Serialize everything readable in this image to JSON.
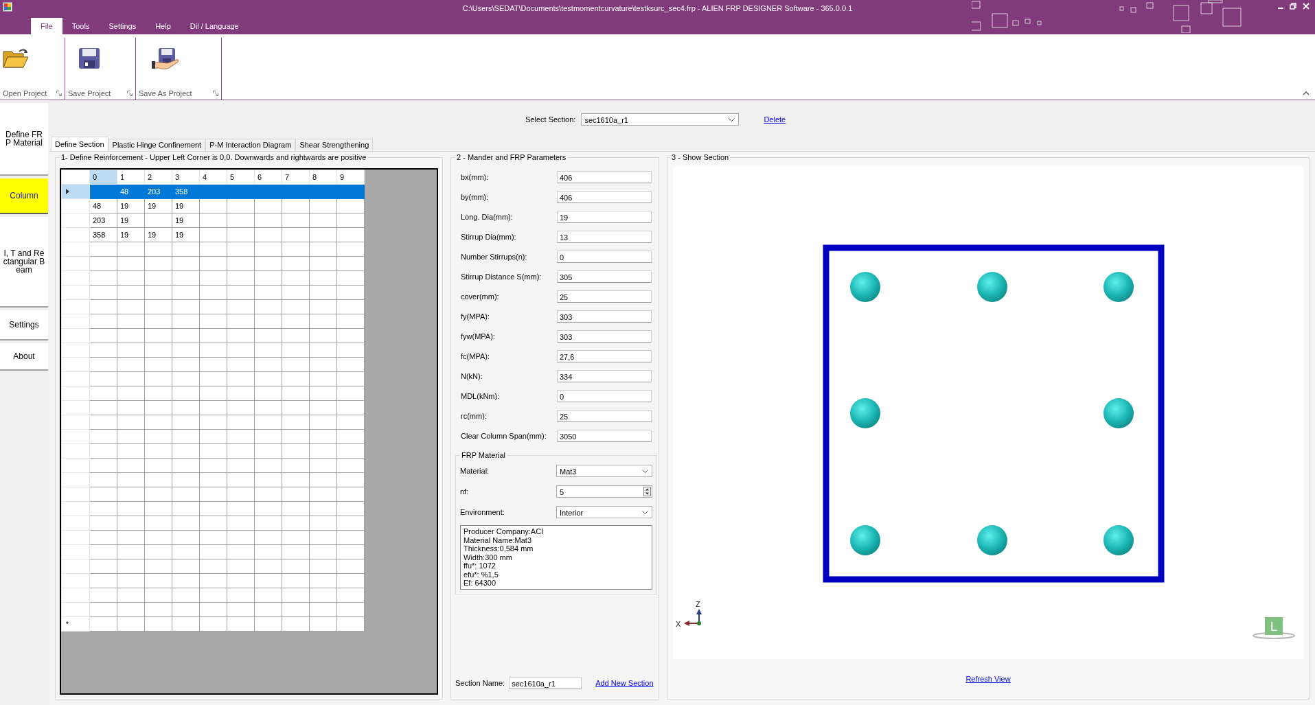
{
  "window": {
    "title": "C:\\Users\\SEDAT\\Documents\\testmomentcurvature\\testksurc_sec4.frp - ALIEN FRP DESIGNER Software - 365.0.0.1"
  },
  "menu": [
    {
      "label": "File",
      "selected": true
    },
    {
      "label": "Tools",
      "selected": false
    },
    {
      "label": "Settings",
      "selected": false
    },
    {
      "label": "Help",
      "selected": false
    },
    {
      "label": "Dil / Language",
      "selected": false
    }
  ],
  "ribbon": {
    "buttons": [
      {
        "label": "Open Project",
        "kind": "open"
      },
      {
        "label": "Save Project",
        "kind": "save"
      },
      {
        "label": "Save As Project",
        "kind": "save_as"
      }
    ]
  },
  "sidebar": {
    "items": [
      {
        "label": "Define FRP Material",
        "selected": false
      },
      {
        "label": "Column",
        "selected": true
      },
      {
        "label": "I, T and Rectangular Beam",
        "selected": false
      },
      {
        "label": "Settings",
        "selected": false
      },
      {
        "label": "About",
        "selected": false
      }
    ]
  },
  "section_select": {
    "label": "Select Section:",
    "value": "sec1610a_r1",
    "delete_link": "Delete"
  },
  "tabs": [
    {
      "label": "Define Section",
      "selected": true
    },
    {
      "label": "Plastic Hinge Confinement",
      "selected": false
    },
    {
      "label": "P-M Interaction Diagram",
      "selected": false
    },
    {
      "label": "Shear Strengthening",
      "selected": false
    }
  ],
  "reinforcement": {
    "title": "1- Define Reinforcement - Upper Left Corner is 0,0. Downwards and rightwards are positive",
    "columns": [
      {
        "label": "0",
        "selected": true
      },
      {
        "label": "1",
        "selected": false
      },
      {
        "label": "2",
        "selected": false
      },
      {
        "label": "3",
        "selected": false
      },
      {
        "label": "4",
        "selected": false
      },
      {
        "label": "5",
        "selected": false
      },
      {
        "label": "6",
        "selected": false
      },
      {
        "label": "7",
        "selected": false
      },
      {
        "label": "8",
        "selected": false
      },
      {
        "label": "9",
        "selected": false
      }
    ],
    "rows": [
      {
        "selected": true,
        "cells": [
          null,
          "48",
          "203",
          "358"
        ]
      },
      {
        "selected": false,
        "cells": [
          "48",
          "19",
          "19",
          "19"
        ]
      },
      {
        "selected": false,
        "cells": [
          "203",
          "19",
          null,
          "19"
        ]
      },
      {
        "selected": false,
        "cells": [
          "358",
          "19",
          "19",
          "19"
        ]
      }
    ],
    "new_row_marker": "*"
  },
  "parameters": {
    "title": "2 - Mander and  FRP Parameters",
    "fields": [
      {
        "label": "bx(mm):",
        "value": "406"
      },
      {
        "label": "by(mm):",
        "value": "406"
      },
      {
        "label": "Long. Dia(mm):",
        "value": "19"
      },
      {
        "label": "Stirrup Dia(mm):",
        "value": "13"
      },
      {
        "label": "Number Stirrups(n):",
        "value": "0"
      },
      {
        "label": "Stirrup Distance S(mm):",
        "value": "305"
      },
      {
        "label": "cover(mm):",
        "value": "25"
      },
      {
        "label": "fy(MPA):",
        "value": "303"
      },
      {
        "label": "fyw(MPA):",
        "value": "303"
      },
      {
        "label": "fc(MPA):",
        "value": "27,6"
      },
      {
        "label": "N(kN):",
        "value": "334"
      },
      {
        "label": "MDL(kNm):",
        "value": "0"
      },
      {
        "label": "rc(mm):",
        "value": "25"
      },
      {
        "label": "Clear Column Span(mm):",
        "value": "3050"
      }
    ]
  },
  "frp_material": {
    "title": "FRP Material",
    "material": {
      "label": "Material:",
      "value": "Mat3"
    },
    "nf": {
      "label": "nf:",
      "value": "5"
    },
    "environment": {
      "label": "Environment:",
      "value": "Interior"
    },
    "info": [
      "Producer Company:ACI",
      "Material Name:Mat3",
      "Thickness:0,584 mm",
      "Width:300 mm",
      "ffu*: 1072",
      "efu*: %1,5",
      "Ef: 64300"
    ]
  },
  "section_name": {
    "label": "Section Name:",
    "value": "sec1610a_r1",
    "add_link": "Add New Section"
  },
  "show_section": {
    "title": "3 - Show Section",
    "axes": {
      "x": "X",
      "z": "Z"
    },
    "view_cube": "L",
    "refresh_link": "Refresh View"
  }
}
